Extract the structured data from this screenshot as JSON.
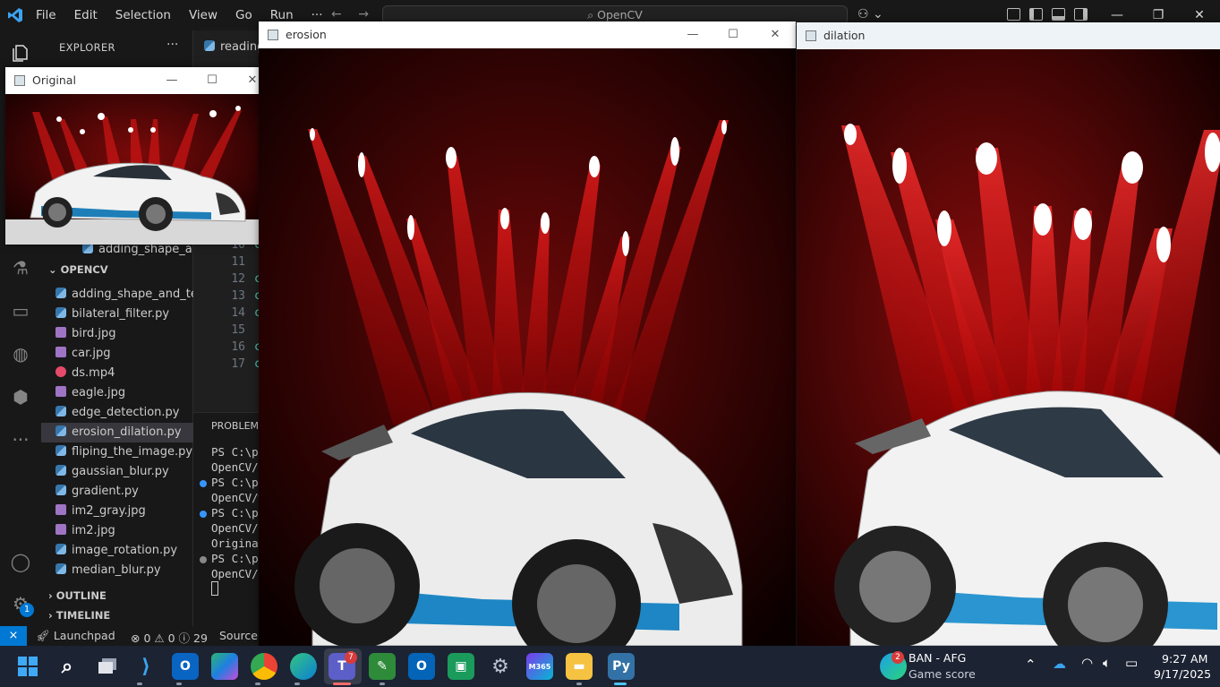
{
  "vscode": {
    "menus": [
      "File",
      "Edit",
      "Selection",
      "View",
      "Go",
      "Run",
      "···"
    ],
    "search_text": "OpenCV",
    "sidebar": {
      "header": "EXPLORER",
      "more": "···",
      "partial_item": "adding_shape_a...",
      "folder": "OPENCV",
      "files": [
        {
          "name": "adding_shape_and_te...",
          "kind": "py"
        },
        {
          "name": "bilateral_filter.py",
          "kind": "py"
        },
        {
          "name": "bird.jpg",
          "kind": "img"
        },
        {
          "name": "car.jpg",
          "kind": "img"
        },
        {
          "name": "ds.mp4",
          "kind": "video"
        },
        {
          "name": "eagle.jpg",
          "kind": "img"
        },
        {
          "name": "edge_detection.py",
          "kind": "py"
        },
        {
          "name": "erosion_dilation.py",
          "kind": "py",
          "selected": true
        },
        {
          "name": "fliping_the_image.py",
          "kind": "py"
        },
        {
          "name": "gaussian_blur.py",
          "kind": "py"
        },
        {
          "name": "gradient.py",
          "kind": "py"
        },
        {
          "name": "im2_gray.jpg",
          "kind": "img"
        },
        {
          "name": "im2.jpg",
          "kind": "img"
        },
        {
          "name": "image_rotation.py",
          "kind": "py"
        },
        {
          "name": "median_blur.py",
          "kind": "py"
        }
      ],
      "outline": "OUTLINE",
      "timeline": "TIMELINE"
    },
    "editor": {
      "tab": "reading",
      "lines": [
        {
          "num": "10",
          "code": "c"
        },
        {
          "num": "11",
          "code": ""
        },
        {
          "num": "12",
          "code": "c"
        },
        {
          "num": "13",
          "code": "c"
        },
        {
          "num": "14",
          "code": "c"
        },
        {
          "num": "15",
          "code": ""
        },
        {
          "num": "16",
          "code": "c"
        },
        {
          "num": "17",
          "code": "c"
        }
      ]
    },
    "panel": {
      "title": "PROBLEMS",
      "terminal": [
        {
          "text": "PS C:\\py",
          "dot": ""
        },
        {
          "text": "OpenCV/r",
          "dot": ""
        },
        {
          "text": "PS C:\\py",
          "dot": "#3794ff"
        },
        {
          "text": "OpenCV/w",
          "dot": ""
        },
        {
          "text": "PS C:\\py",
          "dot": "#3794ff"
        },
        {
          "text": "OpenCV/r",
          "dot": ""
        },
        {
          "text": "Original",
          "dot": ""
        },
        {
          "text": "PS C:\\py",
          "dot": "#888888"
        },
        {
          "text": "OpenCV/e",
          "dot": ""
        }
      ]
    },
    "statusbar": {
      "launchpad": "Launchpad",
      "errors": "0",
      "warnings": "0",
      "info": "29",
      "source": "Sourcery"
    },
    "accounts_badge": "1"
  },
  "windows": {
    "original": {
      "title": "Original"
    },
    "erosion": {
      "title": "erosion"
    },
    "dilation": {
      "title": "dilation"
    }
  },
  "taskbar": {
    "teams_badge": "7",
    "news_badge": "2",
    "score_title": "BAN - AFG",
    "score_sub": "Game score",
    "time": "9:27 AM",
    "date": "9/17/2025"
  },
  "colors": {
    "accent": "#0078d4",
    "vscode_bg": "#1f1f1f",
    "taskbar_bg": "#1c2333"
  }
}
